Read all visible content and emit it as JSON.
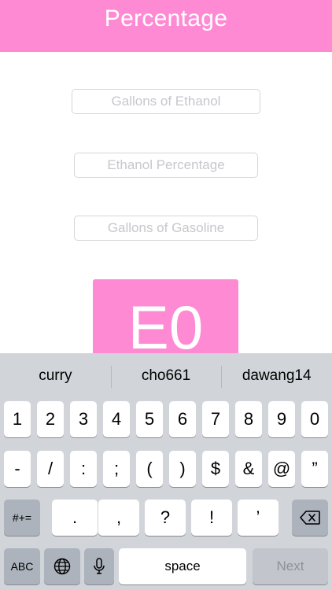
{
  "header": {
    "title": "Percentage"
  },
  "form": {
    "gallons_ethanol_placeholder": "Gallons of Ethanol",
    "ethanol_percentage_placeholder": "Ethanol Percentage",
    "gallons_gasoline_placeholder": "Gallons of Gasoline"
  },
  "result": {
    "value": "E0"
  },
  "keyboard": {
    "suggestions": [
      "curry",
      "cho661",
      "dawang14"
    ],
    "row1": [
      "1",
      "2",
      "3",
      "4",
      "5",
      "6",
      "7",
      "8",
      "9",
      "0"
    ],
    "row2": [
      "-",
      "/",
      ":",
      ";",
      "(",
      ")",
      "$",
      "&",
      "@",
      "”"
    ],
    "row3": [
      "#+=",
      ".",
      ",",
      "?",
      "!",
      "’"
    ],
    "row4": {
      "abc": "ABC",
      "space": "space",
      "next": "Next"
    },
    "icons": {
      "delete": "delete-icon",
      "globe": "globe-icon",
      "mic": "microphone-icon"
    }
  },
  "colors": {
    "accent": "#ff8ad4",
    "keyboard_bg": "#d1d4d9",
    "special_key": "#acb3bd"
  }
}
